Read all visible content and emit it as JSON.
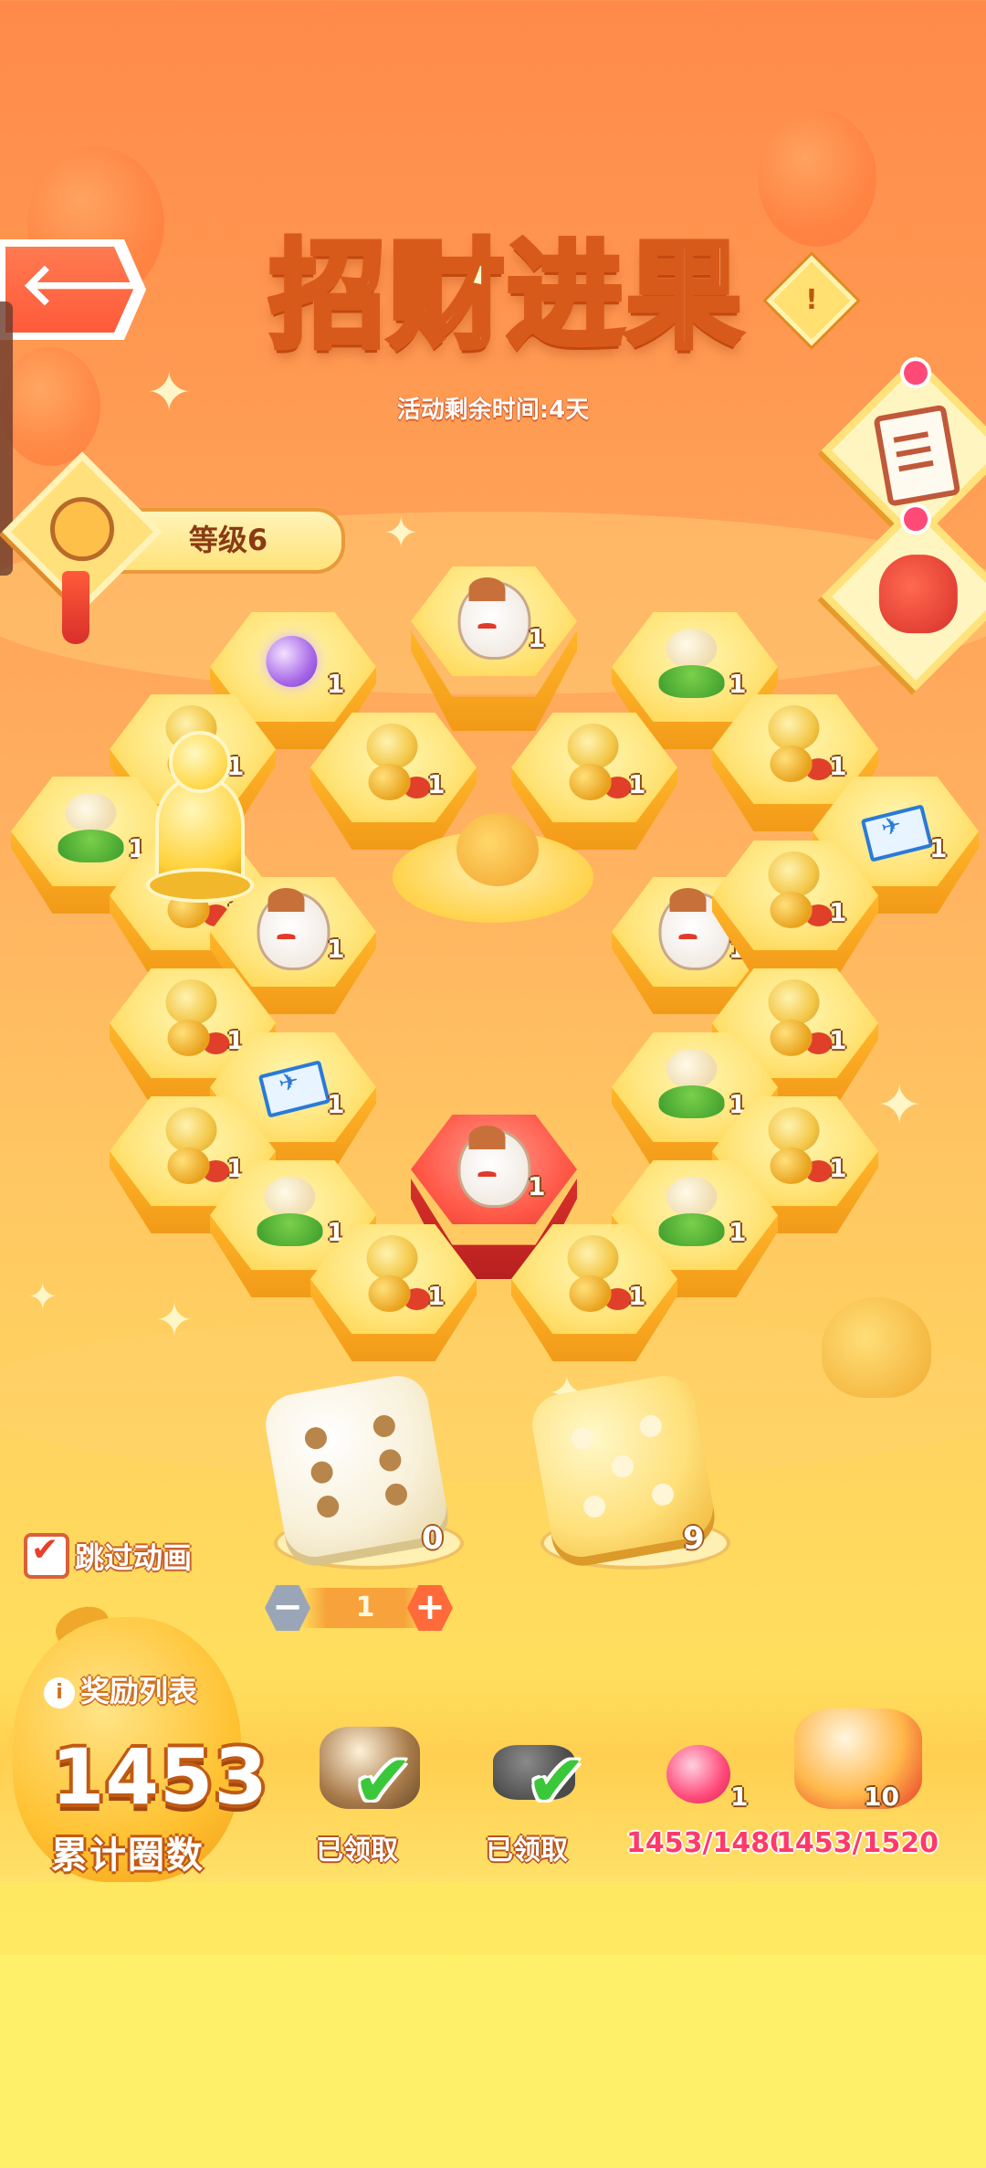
{
  "header": {
    "title": "招财进果",
    "time_remaining": "活动剩余时间:4天",
    "info_symbol": "!"
  },
  "level": {
    "label": "等级6"
  },
  "board": {
    "tiles": [
      {
        "item": "orb-icon",
        "qty": "1"
      },
      {
        "item": "cat-icon",
        "qty": "1"
      },
      {
        "item": "plant-icon",
        "qty": "1"
      },
      {
        "item": "tree-icon",
        "qty": "1"
      },
      {
        "item": "tree-icon",
        "qty": "1"
      },
      {
        "item": "tree-icon",
        "qty": "1"
      },
      {
        "item": "tree-icon",
        "qty": "1"
      },
      {
        "item": "plant-icon",
        "qty": "1"
      },
      {
        "item": "ticket-icon",
        "qty": "1"
      },
      {
        "item": "tree-icon",
        "qty": "1"
      },
      {
        "item": "cat-icon",
        "qty": "1"
      },
      {
        "item": "cat-icon",
        "qty": "1"
      },
      {
        "item": "tree-icon",
        "qty": "1"
      },
      {
        "item": "tree-icon",
        "qty": "1"
      },
      {
        "item": "tree-icon",
        "qty": "1"
      },
      {
        "item": "ticket-icon",
        "qty": "1"
      },
      {
        "item": "plant-icon",
        "qty": "1"
      },
      {
        "item": "tree-icon",
        "qty": "1"
      },
      {
        "item": "tree-icon",
        "qty": "1"
      },
      {
        "item": "cat-icon",
        "qty": "1"
      },
      {
        "item": "plant-icon",
        "qty": "1"
      },
      {
        "item": "plant-icon",
        "qty": "1"
      },
      {
        "item": "tree-icon",
        "qty": "1"
      },
      {
        "item": "tree-icon",
        "qty": "1"
      }
    ]
  },
  "dice": {
    "normal_count": "0",
    "golden_count": "9",
    "stepper_value": "1",
    "minus": "−",
    "plus": "+"
  },
  "skip_animation": {
    "label": "跳过动画",
    "checked": true,
    "check_symbol": "✔"
  },
  "rewards": {
    "list_label": "奖励列表",
    "list_info": "i",
    "total_laps": "1453",
    "total_laps_label": "累计圈数",
    "items": [
      {
        "status": "已领取",
        "claimed": true
      },
      {
        "status": "已领取",
        "claimed": true
      },
      {
        "progress": "1453/1480",
        "qty": "1",
        "claimed": false
      },
      {
        "progress": "1453/1520",
        "qty": "10",
        "claimed": false
      }
    ],
    "check_symbol": "✔"
  },
  "nav": {
    "back_symbol": "🡐"
  }
}
